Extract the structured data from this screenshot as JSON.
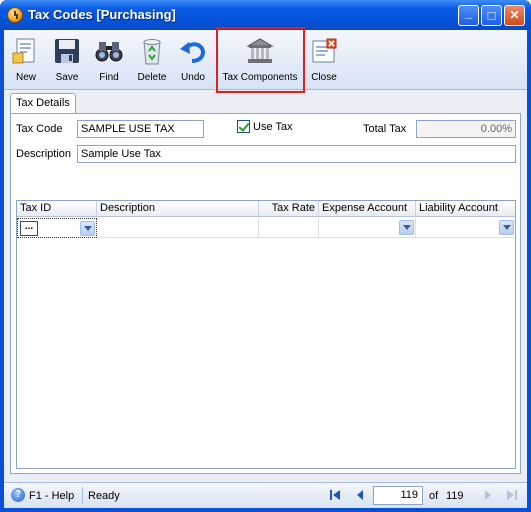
{
  "window": {
    "title": "Tax Codes [Purchasing]",
    "controls": {
      "minimize": "_",
      "maximize": "□",
      "close": "✕"
    }
  },
  "toolbar": {
    "new": "New",
    "save": "Save",
    "find": "Find",
    "delete": "Delete",
    "undo": "Undo",
    "tax_components": "Tax Components",
    "close": "Close"
  },
  "tabs": [
    "Tax Details"
  ],
  "form": {
    "tax_code_label": "Tax Code",
    "tax_code_value": "SAMPLE USE TAX",
    "use_tax_label": "Use Tax",
    "use_tax_checked": true,
    "total_tax_label": "Total Tax",
    "total_tax_value": "0.00%",
    "description_label": "Description",
    "description_value": "Sample Use Tax"
  },
  "grid": {
    "columns": [
      "Tax ID",
      "Description",
      "Tax Rate",
      "Expense Account",
      "Liability Account"
    ],
    "rows": [
      {
        "tax_id": "...",
        "description": "",
        "tax_rate": "",
        "expense_account": "",
        "liability_account": ""
      }
    ]
  },
  "status": {
    "help": "F1 - Help",
    "state": "Ready",
    "current_record": "119",
    "of_label": "of",
    "total_records": "119"
  },
  "colors": {
    "title_bar": "#0452d8",
    "highlight_border": "#e02020",
    "check_mark": "#21a121"
  }
}
